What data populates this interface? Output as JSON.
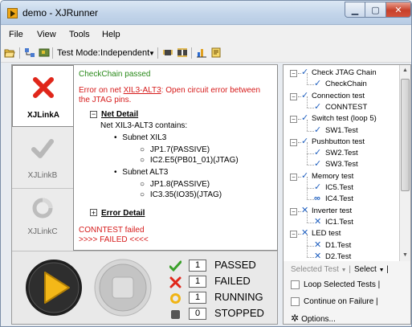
{
  "window": {
    "title": "demo - XJRunner"
  },
  "menu": [
    "File",
    "View",
    "Tools",
    "Help"
  ],
  "toolbar": {
    "test_mode_label": "Test Mode:",
    "test_mode_value": "Independent"
  },
  "tabs": [
    {
      "label": "XJLinkA",
      "icon": "red-x-icon",
      "active": true
    },
    {
      "label": "XJLinkB",
      "icon": "grey-check-icon",
      "active": false
    },
    {
      "label": "XJLinkC",
      "icon": "grey-ring-icon",
      "active": false
    }
  ],
  "log": {
    "checkchain": "CheckChain passed",
    "error_prefix": "Error on net ",
    "error_net": "XIL3-ALT3",
    "error_suffix": ": Open circuit error between",
    "error_line2": "the JTAG pins.",
    "net_detail_heading": "Net Detail",
    "net_contains": "Net XIL3-ALT3 contains:",
    "subnet1": "Subnet XIL3",
    "subnet1_pin1": "JP1.7(PASSIVE)",
    "subnet1_pin2": "IC2.E5(PB01_01)(JTAG)",
    "subnet2": "Subnet ALT3",
    "subnet2_pin1": "JP1.8(PASSIVE)",
    "subnet2_pin2": "IC3.35(IO35)(JTAG)",
    "error_detail_heading": "Error Detail",
    "conntest_failed": "CONNTEST failed",
    "failed_banner": ">>>> FAILED <<<<"
  },
  "status": [
    {
      "count": "1",
      "label": "PASSED",
      "icon": "green-check-icon"
    },
    {
      "count": "1",
      "label": "FAILED",
      "icon": "red-x-icon"
    },
    {
      "count": "1",
      "label": "RUNNING",
      "icon": "running-ring-icon"
    },
    {
      "count": "0",
      "label": "STOPPED",
      "icon": "stopped-square-icon"
    }
  ],
  "tree": [
    {
      "text": "Check JTAG Chain",
      "level": 0,
      "status": "pass"
    },
    {
      "text": "CheckChain",
      "level": 1,
      "status": "pass"
    },
    {
      "text": "Connection test",
      "level": 0,
      "status": "pass"
    },
    {
      "text": "CONNTEST",
      "level": 1,
      "status": "pass"
    },
    {
      "text": "Switch test (loop 5)",
      "level": 0,
      "status": "pass"
    },
    {
      "text": "SW1.Test",
      "level": 1,
      "status": "pass"
    },
    {
      "text": "Pushbutton test",
      "level": 0,
      "status": "pass"
    },
    {
      "text": "SW2.Test",
      "level": 1,
      "status": "pass"
    },
    {
      "text": "SW3.Test",
      "level": 1,
      "status": "pass"
    },
    {
      "text": "Memory test",
      "level": 0,
      "status": "pass"
    },
    {
      "text": "IC5.Test",
      "level": 1,
      "status": "pass"
    },
    {
      "text": "IC4.Test",
      "level": 1,
      "status": "loop"
    },
    {
      "text": "Inverter test",
      "level": 0,
      "status": "fail"
    },
    {
      "text": "IC1.Test",
      "level": 1,
      "status": "fail"
    },
    {
      "text": "LED test",
      "level": 0,
      "status": "fail"
    },
    {
      "text": "D1.Test",
      "level": 1,
      "status": "fail"
    },
    {
      "text": "D2.Test",
      "level": 1,
      "status": "fail"
    }
  ],
  "right_controls": {
    "selected_test": "Selected Test",
    "select": "Select",
    "loop_selected": "Loop Selected Tests",
    "continue_on_failure": "Continue on Failure",
    "options": "Options..."
  },
  "colors": {
    "fail": "#d61a1a",
    "pass": "#2a8a1a",
    "tree_icon": "#1f5fbf",
    "accent_title": "#c3d5ea"
  }
}
